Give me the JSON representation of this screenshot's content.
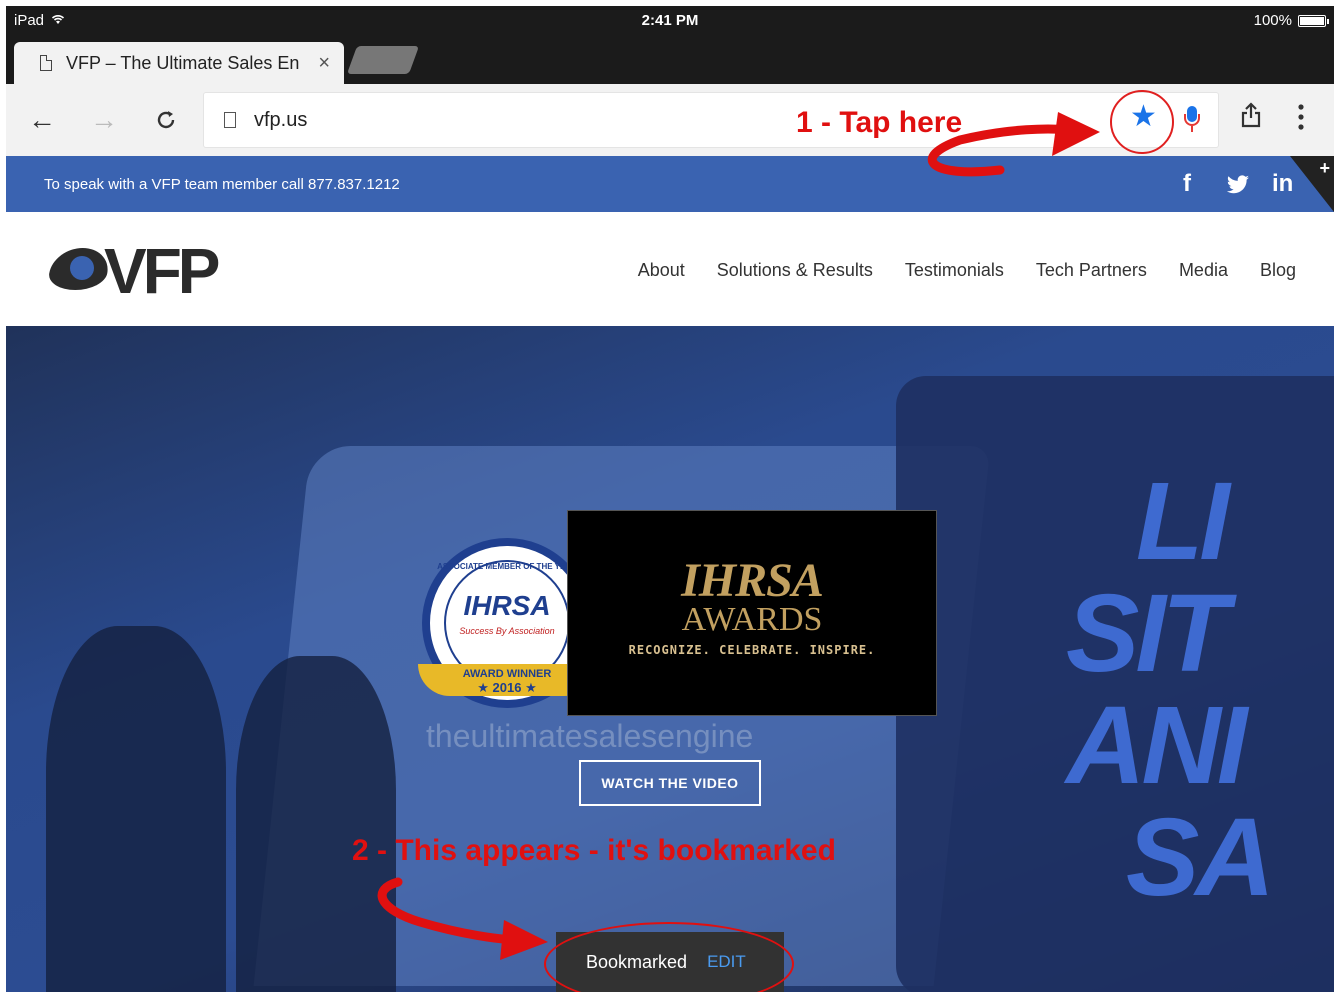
{
  "status_bar": {
    "device": "iPad",
    "time": "2:41 PM",
    "battery": "100%"
  },
  "browser": {
    "tab_title": "VFP – The Ultimate Sales En",
    "tab_close": "×",
    "back_icon": "←",
    "forward_icon": "→",
    "reload_icon": "C",
    "url": "vfp.us",
    "bookmark_icon": "★",
    "share_icon": "⇪",
    "menu_icon": "⋮"
  },
  "annotations": {
    "step1": "1 - Tap here",
    "step2": "2 - This appears - it's bookmarked"
  },
  "site": {
    "topbar": {
      "phone_text": "To speak with a VFP team member call 877.837.1212",
      "social": [
        "f",
        "t",
        "in"
      ],
      "plus": "+"
    },
    "logo_text": "VFP",
    "nav": [
      "About",
      "Solutions & Results",
      "Testimonials",
      "Tech Partners",
      "Media",
      "Blog"
    ],
    "hero": {
      "badge": {
        "ring": "ASSOCIATE MEMBER OF THE YEAR",
        "title": "IHRSA",
        "subtitle": "Success By Association",
        "ribbon": "AWARD WINNER",
        "year": "★ 2016 ★"
      },
      "video": {
        "title": "IHRSA",
        "subtitle": "AWARDS",
        "tagline": "RECOGNIZE. CELEBRATE. INSPIRE."
      },
      "faint_brand": "theultimatesalesengine",
      "big_text": [
        "LI",
        "SIT",
        "ANI",
        "SA"
      ],
      "cta": "WATCH THE VIDEO"
    }
  },
  "snackbar": {
    "message": "Bookmarked",
    "action": "EDIT"
  },
  "colors": {
    "brand_blue": "#3a63b1",
    "link_blue": "#1a73e8",
    "annotation_red": "#e01010"
  }
}
